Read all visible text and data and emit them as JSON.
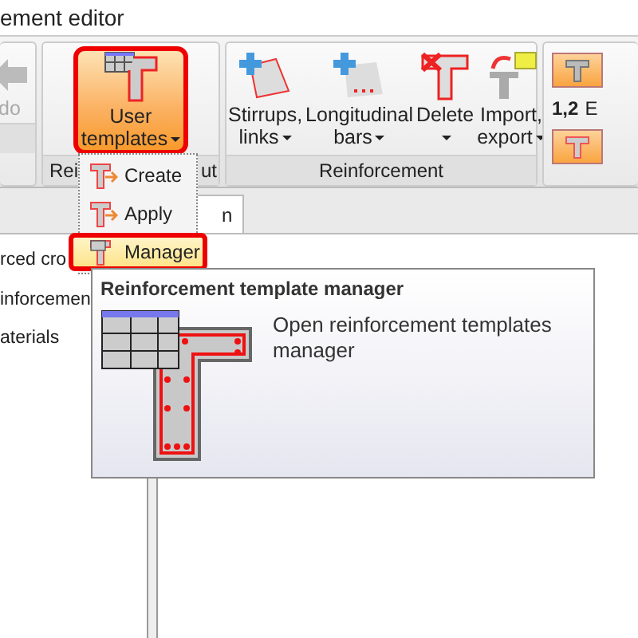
{
  "window": {
    "title": "ement editor"
  },
  "ribbon": {
    "undo_button": {
      "label": "do",
      "disabled": true
    },
    "template_group": {
      "label_parts": [
        "Rei",
        "ut"
      ],
      "button": {
        "label_lines": [
          "User",
          "templates"
        ],
        "dropdown": true,
        "pressed": true,
        "highlighted": true
      }
    },
    "reinforcement_group": {
      "label": "Reinforcement",
      "buttons": [
        {
          "label_lines": [
            "Stirrups,",
            "links"
          ],
          "dropdown": true
        },
        {
          "label_lines": [
            "Longitudinal",
            "bars"
          ],
          "dropdown": true
        },
        {
          "label_lines": [
            "Delete"
          ],
          "dropdown": true
        },
        {
          "label_lines": [
            "Import,",
            "export"
          ],
          "dropdown": true
        }
      ]
    },
    "partial_group": {
      "number_label": "1,2",
      "text": "E"
    }
  },
  "dropdown_menu": {
    "items": [
      {
        "label": "Create",
        "selected": false,
        "highlighted": false
      },
      {
        "label": "Apply",
        "selected": false,
        "highlighted": false
      },
      {
        "label": "Manager",
        "selected": true,
        "highlighted": true
      }
    ]
  },
  "tab_strip": {
    "tabs": [
      {
        "label": "n"
      }
    ]
  },
  "tree": {
    "items": [
      "rced cro",
      "inforcemen",
      "aterials"
    ]
  },
  "tooltip": {
    "title": "Reinforcement template manager",
    "description": "Open reinforcement templates manager"
  }
}
